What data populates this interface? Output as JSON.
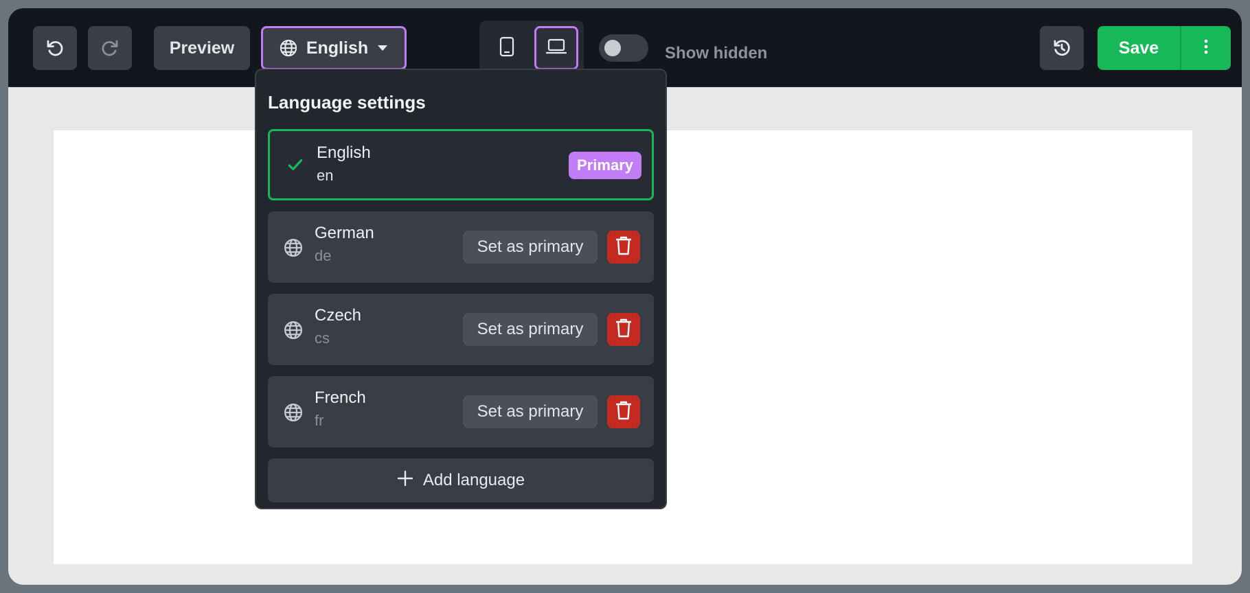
{
  "colors": {
    "toolbar_bg": "#13171d",
    "accent": "#c27cf6",
    "save_green": "#16b857",
    "delete_red": "#c42a20"
  },
  "toolbar": {
    "undo_icon": "undo-icon",
    "redo_icon": "redo-icon",
    "preview_label": "Preview",
    "language_label": "English",
    "device_mobile_icon": "mobile-icon",
    "device_desktop_icon": "laptop-icon",
    "device_selected": "desktop",
    "show_hidden_label": "Show hidden",
    "show_hidden_on": false,
    "history_icon": "history-icon",
    "save_label": "Save"
  },
  "language_popover": {
    "title": "Language settings",
    "primary_badge": "Primary",
    "set_primary_label": "Set as primary",
    "add_language_label": "Add language",
    "languages": [
      {
        "name": "English",
        "code": "en",
        "primary": true
      },
      {
        "name": "German",
        "code": "de",
        "primary": false
      },
      {
        "name": "Czech",
        "code": "cs",
        "primary": false
      },
      {
        "name": "French",
        "code": "fr",
        "primary": false
      }
    ]
  }
}
